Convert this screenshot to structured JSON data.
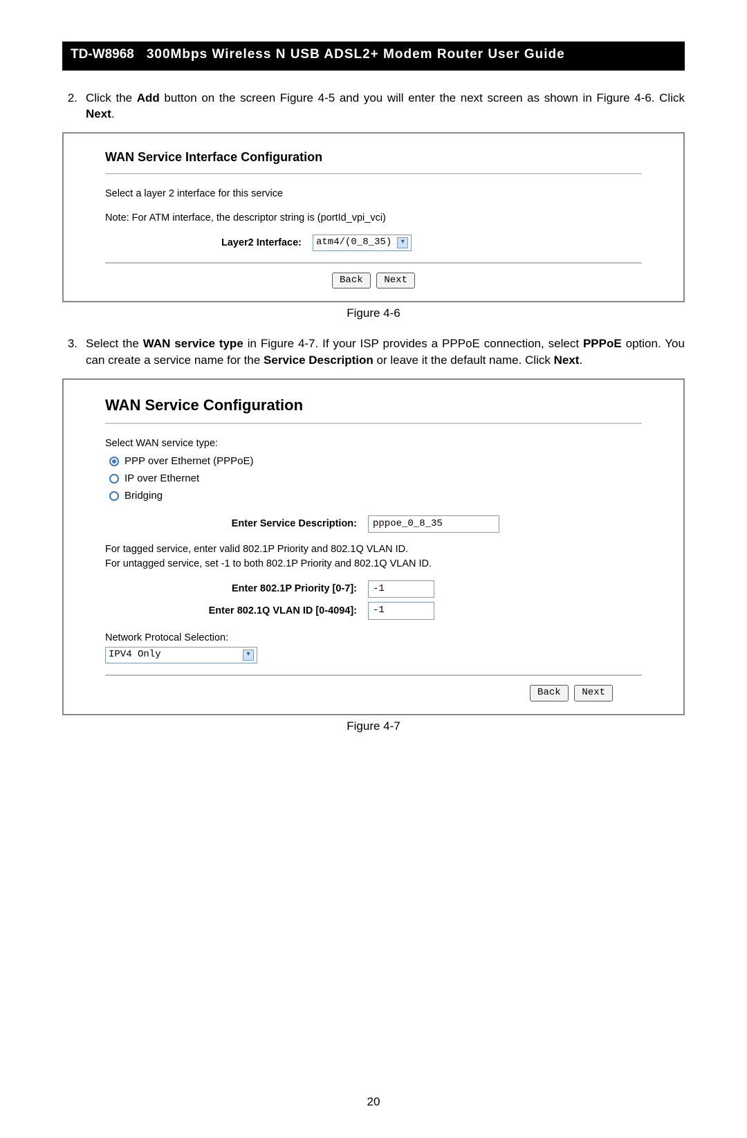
{
  "header": {
    "model": "TD-W8968",
    "title": "300Mbps Wireless N USB ADSL2+ Modem Router User Guide"
  },
  "step2": {
    "num": "2.",
    "pre": "Click the ",
    "add": "Add",
    "mid1": " button on the screen ",
    "fig45": "Figure 4-5",
    "mid2": " and you will enter the next screen as shown in ",
    "fig46": "Figure 4-6",
    "mid3": ". Click ",
    "next": "Next",
    "end": "."
  },
  "panel1": {
    "heading": "WAN Service Interface Configuration",
    "line1": "Select a layer 2 interface for this service",
    "line2": "Note: For ATM interface, the descriptor string is (portId_vpi_vci)",
    "field_label": "Layer2 Interface:",
    "field_value": "atm4/(0_8_35)",
    "back": "Back",
    "next": "Next",
    "caption": "Figure 4-6"
  },
  "step3": {
    "num": "3.",
    "t1": "Select the ",
    "b1": "WAN service type",
    "t2": " in ",
    "fig47": "Figure 4-7",
    "t3": ". If your ISP provides a PPPoE connection, select ",
    "b2": "PPPoE",
    "t4": " option. You can create a service name for the ",
    "b3": "Service Description",
    "t5": " or leave it the default name. Click ",
    "b4": "Next",
    "t6": "."
  },
  "panel2": {
    "heading": "WAN Service Configuration",
    "select_label": "Select WAN service type:",
    "r1": "PPP over Ethernet (PPPoE)",
    "r2": "IP over Ethernet",
    "r3": "Bridging",
    "svc_label": "Enter Service Description:",
    "svc_value": "pppoe_0_8_35",
    "tag_line1": "For tagged service, enter valid 802.1P Priority and 802.1Q VLAN ID.",
    "tag_line2": "For untagged service, set -1 to both 802.1P Priority and 802.1Q VLAN ID.",
    "prio_label": "Enter 802.1P Priority [0-7]:",
    "prio_value": "-1",
    "vlan_label": "Enter 802.1Q VLAN ID [0-4094]:",
    "vlan_value": "-1",
    "proto_label": "Network Protocal Selection:",
    "proto_value": "IPV4 Only",
    "back": "Back",
    "next": "Next",
    "caption": "Figure 4-7"
  },
  "page_number": "20"
}
